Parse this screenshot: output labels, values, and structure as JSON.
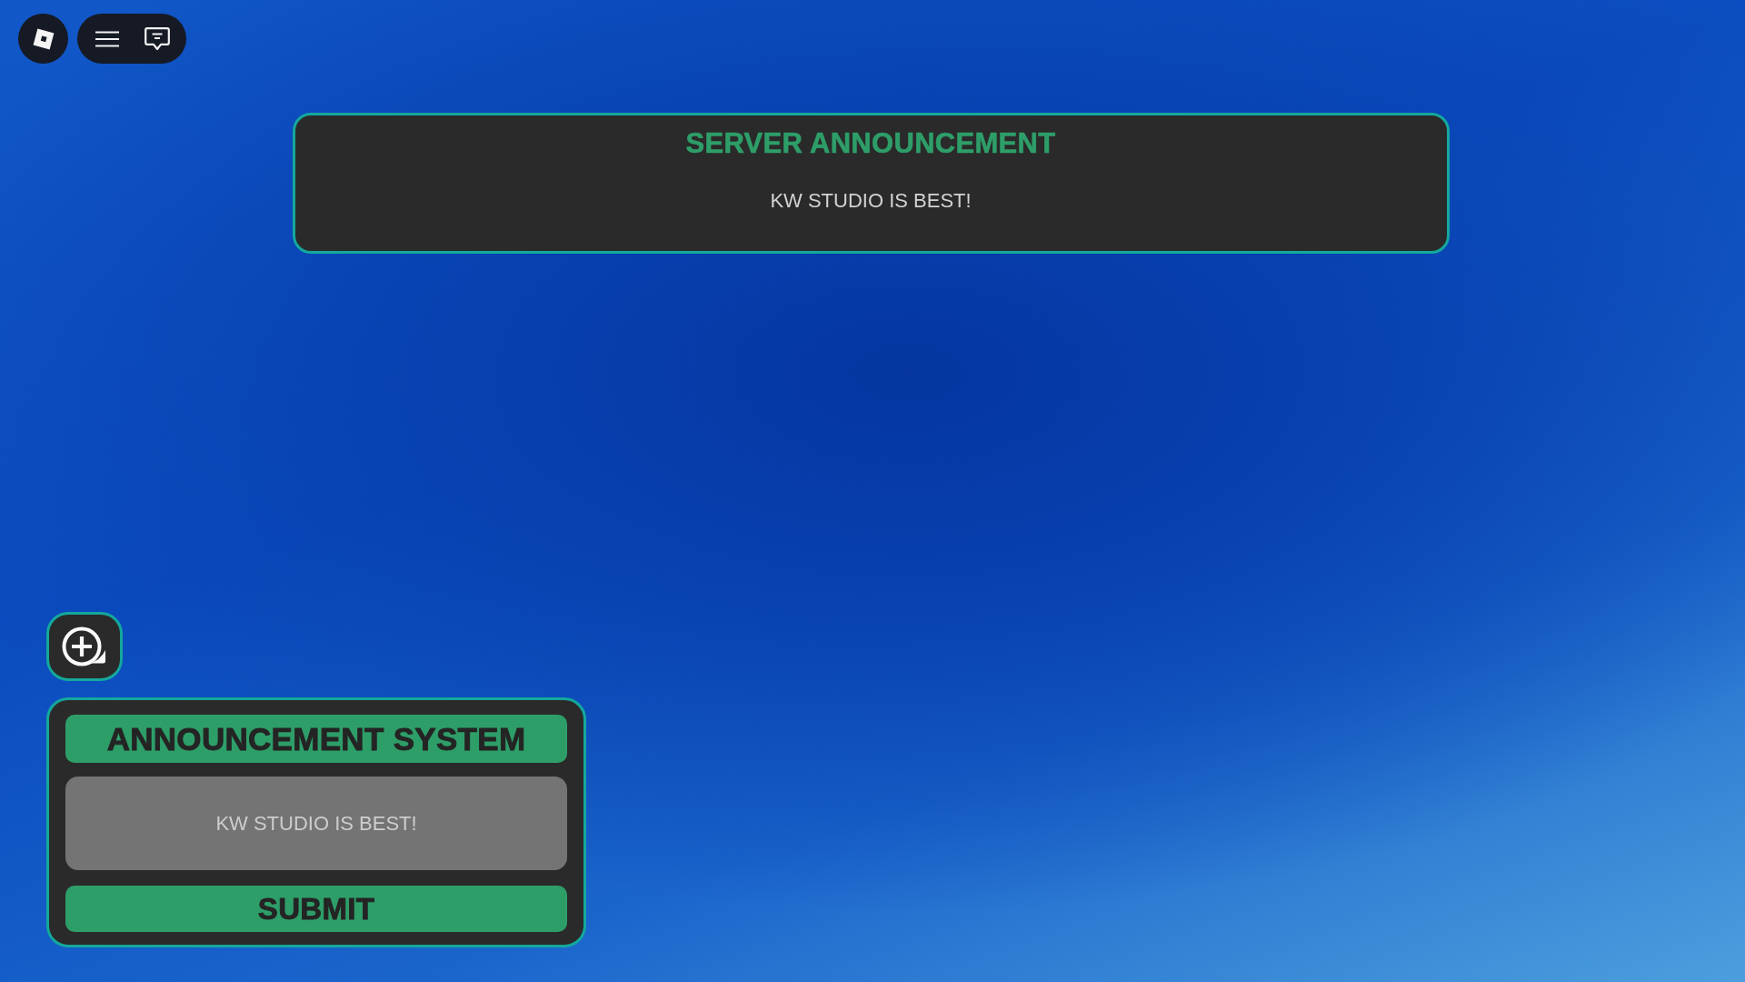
{
  "top_bar": {
    "buttons": [
      {
        "kind": "logo"
      },
      {
        "kind": "menu"
      },
      {
        "kind": "chat"
      }
    ]
  },
  "server_announcement": {
    "title": "SERVER ANNOUNCEMENT",
    "message": "KW STUDIO IS BEST!"
  },
  "announcement_panel": {
    "toggle_button": {
      "kind": "add"
    },
    "title": "ANNOUNCEMENT SYSTEM",
    "message_field": {
      "value": "KW STUDIO IS BEST!"
    },
    "submit_button": "SUBMIT"
  }
}
